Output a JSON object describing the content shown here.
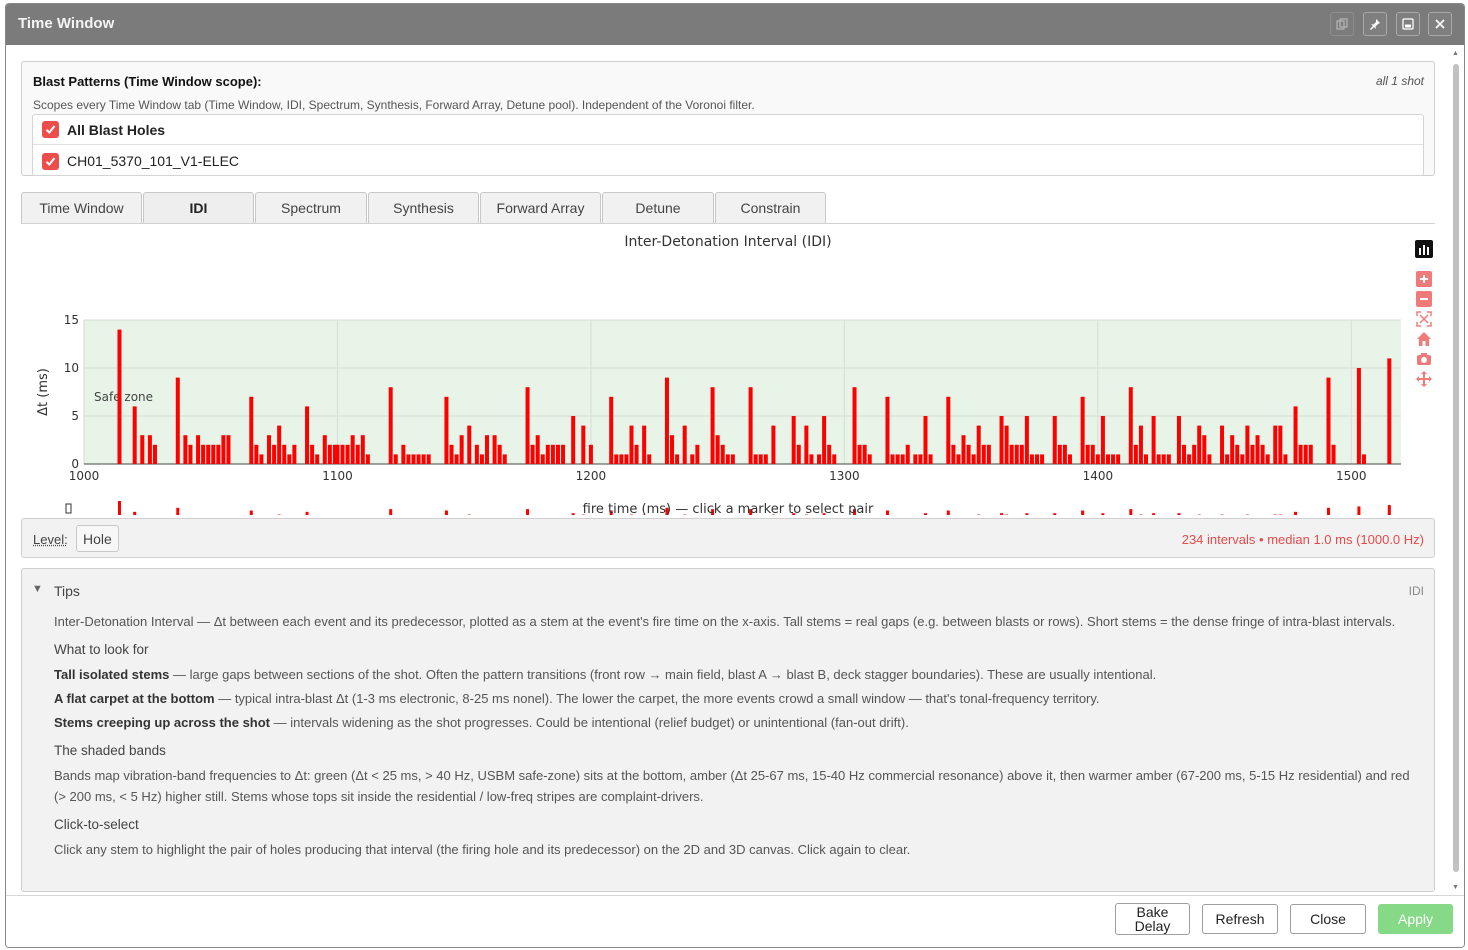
{
  "window": {
    "title": "Time Window"
  },
  "patterns": {
    "heading": "Blast Patterns (Time Window scope):",
    "shot_info": "all 1 shot",
    "description": "Scopes every Time Window tab (Time Window, IDI, Spectrum, Synthesis, Forward Array, Detune pool). Independent of the Voronoi filter.",
    "items": [
      {
        "label": "All Blast Holes",
        "checked": true
      },
      {
        "label": "CH01_5370_101_V1-ELEC",
        "checked": true
      }
    ]
  },
  "tabs": [
    {
      "label": "Time Window",
      "active": false
    },
    {
      "label": "IDI",
      "active": true
    },
    {
      "label": "Spectrum",
      "active": false
    },
    {
      "label": "Synthesis",
      "active": false
    },
    {
      "label": "Forward Array",
      "active": false
    },
    {
      "label": "Detune",
      "active": false
    },
    {
      "label": "Constrain",
      "active": false
    }
  ],
  "chart_data": {
    "type": "bar",
    "title": "Inter-Detonation Interval (IDI)",
    "xlabel": "fire time (ms) — click a marker to select pair",
    "ylabel": "Δt (ms)",
    "xlim": [
      1000,
      1520
    ],
    "ylim": [
      0,
      15
    ],
    "x_ticks": [
      1000,
      1100,
      1200,
      1300,
      1400,
      1500
    ],
    "y_ticks": [
      0,
      5,
      10,
      15
    ],
    "band_label": "Safe zone",
    "grid": true,
    "colors": {
      "stem": "#ff0000",
      "band": "#e8f4e8",
      "rangeslider_stem": "#ff0000"
    },
    "stems": [
      [
        1014,
        14
      ],
      [
        1020,
        6
      ],
      [
        1023,
        3
      ],
      [
        1026,
        3
      ],
      [
        1028,
        2
      ],
      [
        1037,
        9
      ],
      [
        1040,
        3
      ],
      [
        1042,
        2
      ],
      [
        1045,
        3
      ],
      [
        1047,
        2
      ],
      [
        1049,
        2
      ],
      [
        1051,
        2
      ],
      [
        1053,
        2
      ],
      [
        1055,
        3
      ],
      [
        1057,
        3
      ],
      [
        1066,
        7
      ],
      [
        1068,
        2
      ],
      [
        1070,
        1
      ],
      [
        1073,
        3
      ],
      [
        1075,
        2
      ],
      [
        1077,
        4
      ],
      [
        1079,
        2
      ],
      [
        1081,
        1
      ],
      [
        1083,
        2
      ],
      [
        1088,
        6
      ],
      [
        1090,
        2
      ],
      [
        1092,
        1
      ],
      [
        1095,
        3
      ],
      [
        1097,
        2
      ],
      [
        1099,
        2
      ],
      [
        1100,
        2
      ],
      [
        1102,
        2
      ],
      [
        1104,
        2
      ],
      [
        1106,
        3
      ],
      [
        1108,
        2
      ],
      [
        1110,
        3
      ],
      [
        1112,
        1
      ],
      [
        1121,
        8
      ],
      [
        1123,
        1
      ],
      [
        1126,
        2
      ],
      [
        1128,
        1
      ],
      [
        1130,
        1
      ],
      [
        1132,
        1
      ],
      [
        1134,
        1
      ],
      [
        1136,
        1
      ],
      [
        1143,
        7
      ],
      [
        1145,
        2
      ],
      [
        1147,
        1
      ],
      [
        1149,
        3
      ],
      [
        1152,
        4
      ],
      [
        1155,
        2
      ],
      [
        1157,
        1
      ],
      [
        1159,
        3
      ],
      [
        1162,
        3
      ],
      [
        1164,
        2
      ],
      [
        1166,
        1
      ],
      [
        1175,
        8
      ],
      [
        1177,
        2
      ],
      [
        1179,
        3
      ],
      [
        1181,
        1
      ],
      [
        1183,
        2
      ],
      [
        1185,
        2
      ],
      [
        1187,
        2
      ],
      [
        1189,
        2
      ],
      [
        1193,
        5
      ],
      [
        1197,
        4
      ],
      [
        1200,
        2
      ],
      [
        1208,
        7
      ],
      [
        1210,
        1
      ],
      [
        1212,
        1
      ],
      [
        1214,
        1
      ],
      [
        1216,
        4
      ],
      [
        1218,
        2
      ],
      [
        1221,
        4
      ],
      [
        1223,
        1
      ],
      [
        1230,
        9
      ],
      [
        1232,
        3
      ],
      [
        1234,
        1
      ],
      [
        1237,
        4
      ],
      [
        1240,
        1
      ],
      [
        1242,
        2
      ],
      [
        1248,
        8
      ],
      [
        1250,
        3
      ],
      [
        1252,
        2
      ],
      [
        1254,
        1
      ],
      [
        1256,
        1
      ],
      [
        1263,
        8
      ],
      [
        1265,
        1
      ],
      [
        1267,
        1
      ],
      [
        1269,
        1
      ],
      [
        1272,
        4
      ],
      [
        1280,
        5
      ],
      [
        1282,
        2
      ],
      [
        1285,
        4
      ],
      [
        1287,
        1
      ],
      [
        1290,
        1
      ],
      [
        1292,
        5
      ],
      [
        1294,
        2
      ],
      [
        1296,
        1
      ],
      [
        1304,
        8
      ],
      [
        1306,
        2
      ],
      [
        1308,
        2
      ],
      [
        1310,
        1
      ],
      [
        1317,
        7
      ],
      [
        1319,
        1
      ],
      [
        1321,
        1
      ],
      [
        1323,
        1
      ],
      [
        1325,
        2
      ],
      [
        1328,
        1
      ],
      [
        1330,
        1
      ],
      [
        1332,
        5
      ],
      [
        1334,
        1
      ],
      [
        1341,
        7
      ],
      [
        1343,
        2
      ],
      [
        1345,
        1
      ],
      [
        1347,
        3
      ],
      [
        1349,
        2
      ],
      [
        1351,
        1
      ],
      [
        1353,
        4
      ],
      [
        1355,
        2
      ],
      [
        1357,
        2
      ],
      [
        1362,
        5
      ],
      [
        1364,
        4
      ],
      [
        1366,
        2
      ],
      [
        1368,
        2
      ],
      [
        1370,
        2
      ],
      [
        1372,
        5
      ],
      [
        1374,
        1
      ],
      [
        1376,
        1
      ],
      [
        1378,
        1
      ],
      [
        1383,
        5
      ],
      [
        1385,
        2
      ],
      [
        1387,
        2
      ],
      [
        1389,
        1
      ],
      [
        1394,
        7
      ],
      [
        1396,
        2
      ],
      [
        1398,
        2
      ],
      [
        1400,
        1
      ],
      [
        1402,
        5
      ],
      [
        1404,
        1
      ],
      [
        1406,
        1
      ],
      [
        1408,
        1
      ],
      [
        1413,
        8
      ],
      [
        1415,
        2
      ],
      [
        1417,
        4
      ],
      [
        1419,
        1
      ],
      [
        1422,
        5
      ],
      [
        1424,
        1
      ],
      [
        1426,
        1
      ],
      [
        1428,
        1
      ],
      [
        1432,
        5
      ],
      [
        1434,
        2
      ],
      [
        1436,
        1
      ],
      [
        1438,
        2
      ],
      [
        1440,
        4
      ],
      [
        1442,
        3
      ],
      [
        1444,
        1
      ],
      [
        1449,
        4
      ],
      [
        1451,
        1
      ],
      [
        1453,
        3
      ],
      [
        1455,
        2
      ],
      [
        1457,
        1
      ],
      [
        1459,
        4
      ],
      [
        1461,
        2
      ],
      [
        1463,
        3
      ],
      [
        1465,
        2
      ],
      [
        1467,
        1
      ],
      [
        1470,
        4
      ],
      [
        1472,
        4
      ],
      [
        1474,
        1
      ],
      [
        1478,
        6
      ],
      [
        1480,
        2
      ],
      [
        1482,
        2
      ],
      [
        1484,
        2
      ],
      [
        1491,
        9
      ],
      [
        1493,
        2
      ],
      [
        1503,
        10
      ],
      [
        1505,
        1
      ],
      [
        1515,
        11
      ]
    ]
  },
  "level": {
    "label": "Level:",
    "value": "Hole",
    "stats": "234 intervals • median 1.0 ms (1000.0 Hz)"
  },
  "tips": {
    "title": "Tips",
    "tag": "IDI",
    "intro": "Inter-Detonation Interval — Δt between each event and its predecessor, plotted as a stem at the event's fire time on the x-axis. Tall stems = real gaps (e.g. between blasts or rows). Short stems = the dense fringe of intra-blast intervals.",
    "look_heading": "What to look for",
    "items": [
      {
        "bold": "Tall isolated stems",
        "text": " — large gaps between sections of the shot. Often the pattern transitions (front row → main field, blast A → blast B, deck stagger boundaries). These are usually intentional."
      },
      {
        "bold": "A flat carpet at the bottom",
        "text": " — typical intra-blast Δt (1-3 ms electronic, 8-25 ms nonel). The lower the carpet, the more events crowd a small window — that's tonal-frequency territory."
      },
      {
        "bold": "Stems creeping up across the shot",
        "text": " — intervals widening as the shot progresses. Could be intentional (relief budget) or unintentional (fan-out drift)."
      }
    ],
    "bands_heading": "The shaded bands",
    "bands_text": "Bands map vibration-band frequencies to Δt: green (Δt < 25 ms, > 40 Hz, USBM safe-zone) sits at the bottom, amber (Δt 25-67 ms, 15-40 Hz commercial resonance) above it, then warmer amber (67-200 ms, 5-15 Hz residential) and red (> 200 ms, < 5 Hz) higher still. Stems whose tops sit inside the residential / low-freq stripes are complaint-drivers.",
    "click_heading": "Click-to-select",
    "click_text": "Click any stem to highlight the pair of holes producing that interval (the firing hole and its predecessor) on the 2D and 3D canvas. Click again to clear."
  },
  "footer": {
    "bake_label_1": "Bake",
    "bake_label_2": "Delay",
    "refresh_label": "Refresh",
    "close_label": "Close",
    "apply_label": "Apply"
  },
  "icons": {
    "window_buttons": [
      "copy-icon",
      "pin-icon",
      "save-icon",
      "close-icon"
    ],
    "chart_modebar": [
      "plotly-logo-icon",
      "zoom-in-icon",
      "zoom-out-icon",
      "autoscale-icon",
      "reset-home-icon",
      "camera-icon",
      "pan-icon"
    ]
  }
}
